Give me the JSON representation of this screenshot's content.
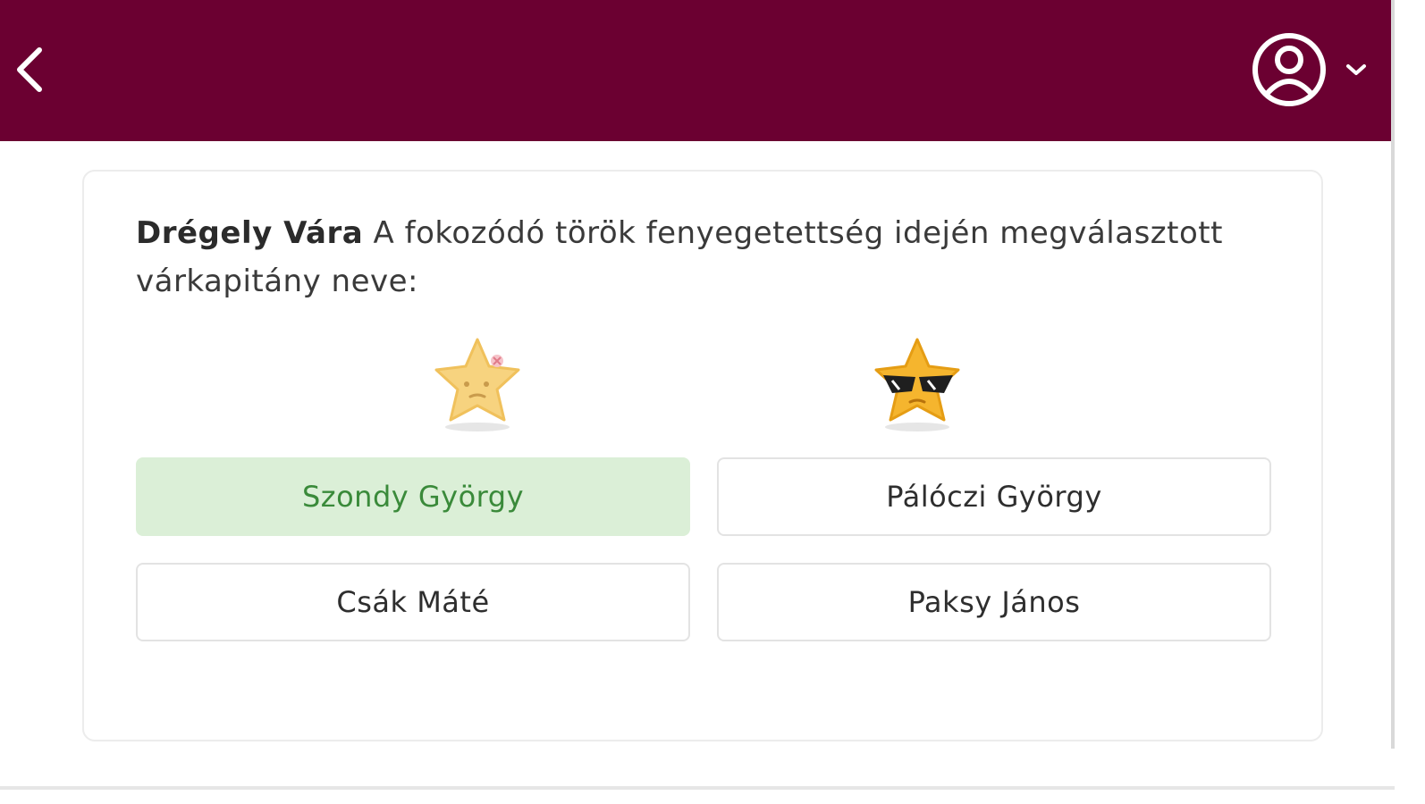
{
  "header": {
    "back_icon": "chevron-left-icon",
    "user_icon": "user-circle-icon",
    "dropdown_icon": "chevron-down-icon",
    "background_color": "#6b0031"
  },
  "question": {
    "title": "Drégely Vára",
    "text": " A fokozódó török fenyegetettség idején megválasztott várkapitány neve:"
  },
  "mascots": [
    {
      "name": "sad-star-mascot"
    },
    {
      "name": "cool-star-mascot"
    }
  ],
  "answers": [
    {
      "label": "Szondy György",
      "state": "correct",
      "color": "#dbefd7"
    },
    {
      "label": "Pálóczi György",
      "state": "default"
    },
    {
      "label": "Csák Máté",
      "state": "default"
    },
    {
      "label": "Paksy János",
      "state": "default"
    }
  ]
}
